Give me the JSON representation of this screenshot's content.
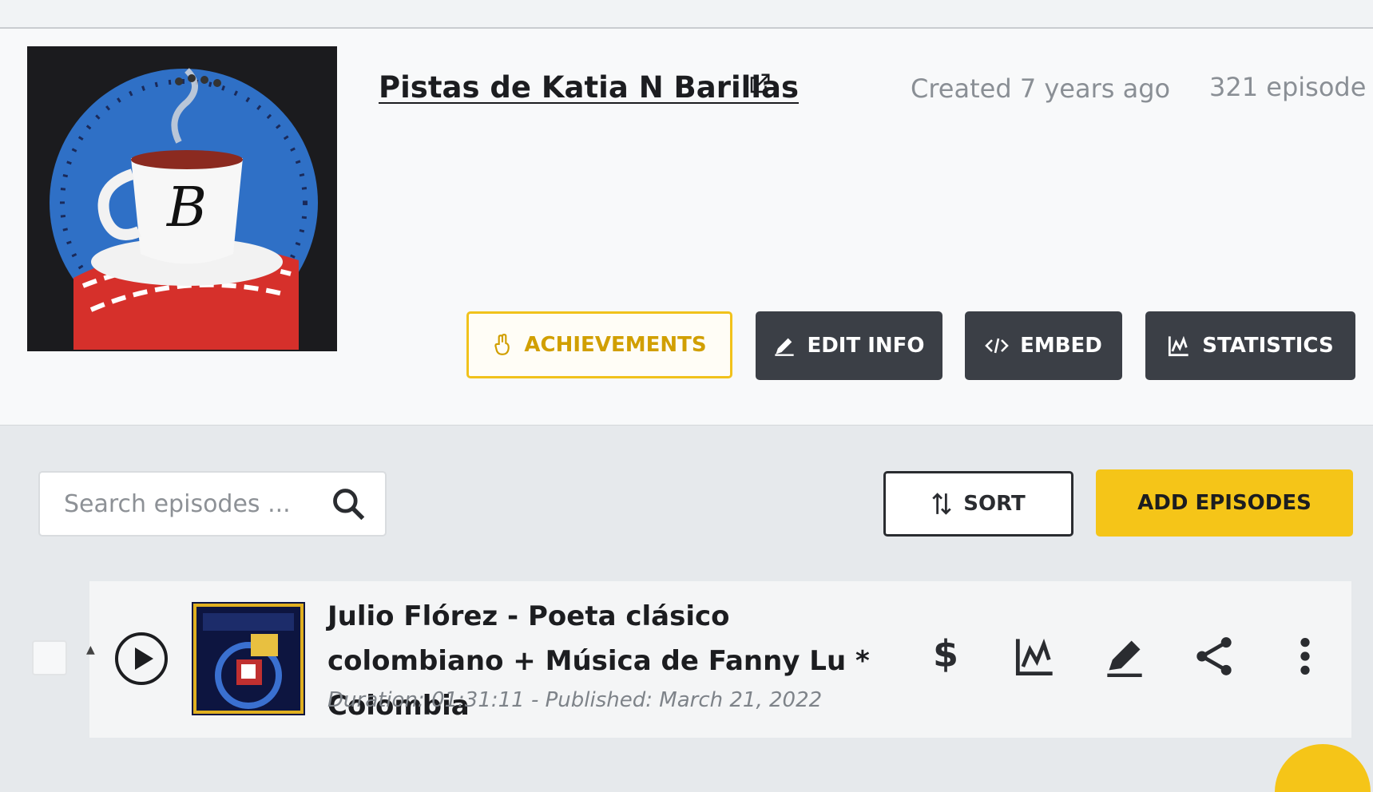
{
  "podcast": {
    "title": "Pistas de Katia N Barillas",
    "created": "Created 7 years ago",
    "episodes": "321 episode",
    "cover_letter": "B"
  },
  "actions": {
    "achievements": "ACHIEVEMENTS",
    "edit_info": "EDIT INFO",
    "embed": "EMBED",
    "statistics": "STATISTICS"
  },
  "toolbar": {
    "search_placeholder": "Search episodes ...",
    "sort": "SORT",
    "add_episodes": "ADD EPISODES"
  },
  "episode": {
    "title": "Julio Flórez - Poeta clásico colombiano + Música de Fanny Lu * Colombia",
    "meta": "Duration: 01:31:11 - Published: March 21, 2022",
    "monetize_symbol": "$"
  },
  "colors": {
    "accent": "#f5c518",
    "accent_text": "#d19f00",
    "dark_button": "#3b3f46"
  },
  "icons": [
    "external-link-icon",
    "hand-icon",
    "pencil-icon",
    "code-icon",
    "chart-icon",
    "sort-icon",
    "search-icon",
    "play-icon",
    "dollar-icon",
    "share-icon",
    "more-vertical-icon"
  ]
}
